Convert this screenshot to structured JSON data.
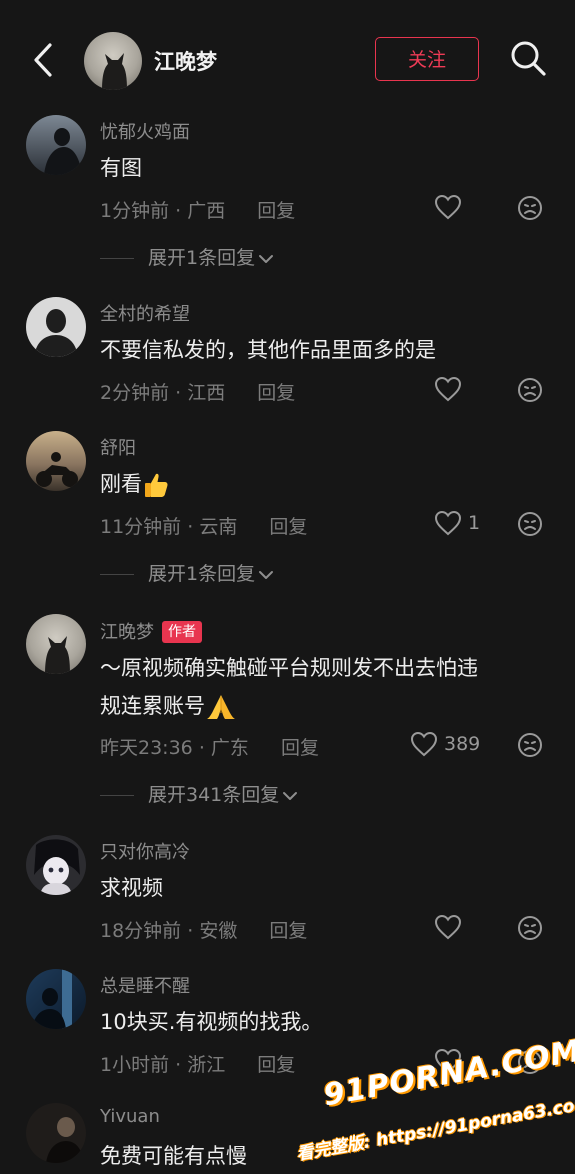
{
  "header": {
    "title": "江晚梦",
    "follow_label": "关注"
  },
  "comments": [
    {
      "username": "忧郁火鸡面",
      "text": "有图",
      "time": "1分钟前",
      "location": "广西",
      "reply_label": "回复",
      "likes": "",
      "expand": "展开1条回复"
    },
    {
      "username": "全村的希望",
      "text": "不要信私发的，其他作品里面多的是",
      "time": "2分钟前",
      "location": "江西",
      "reply_label": "回复",
      "likes": ""
    },
    {
      "username": "舒阳",
      "text": "刚看",
      "emoji": "thumbs-up",
      "time": "11分钟前",
      "location": "云南",
      "reply_label": "回复",
      "likes": "1",
      "expand": "展开1条回复"
    },
    {
      "username": "江晚梦",
      "badge": "作者",
      "text_line1": "～原视频确实触碰平台规则发不出去怕违",
      "text_line2": "规连累账号",
      "emoji": "folded-hands",
      "time": "昨天23:36",
      "location": "广东",
      "reply_label": "回复",
      "likes": "389",
      "expand": "展开341条回复"
    },
    {
      "username": "只对你高冷",
      "text": "求视频",
      "time": "18分钟前",
      "location": "安徽",
      "reply_label": "回复",
      "likes": ""
    },
    {
      "username": "总是睡不醒",
      "text": "10块买.有视频的找我。",
      "time": "1小时前",
      "location": "浙江",
      "reply_label": "回复",
      "likes": ""
    },
    {
      "username": "Yivuan",
      "text": "免费可能有点慢"
    }
  ],
  "watermark": {
    "logo": "91PORNA.COM",
    "url": "看完整版: https://91porna63.com"
  },
  "icons": {
    "back": "chevron-left-icon",
    "search": "search-icon",
    "like": "heart-outline-icon",
    "dislike": "frown-face-icon",
    "expand": "chevron-down-icon"
  },
  "colors": {
    "background": "#161616",
    "accent": "#e8354f",
    "text_primary": "#ededed",
    "text_secondary": "#8c8c8c"
  }
}
